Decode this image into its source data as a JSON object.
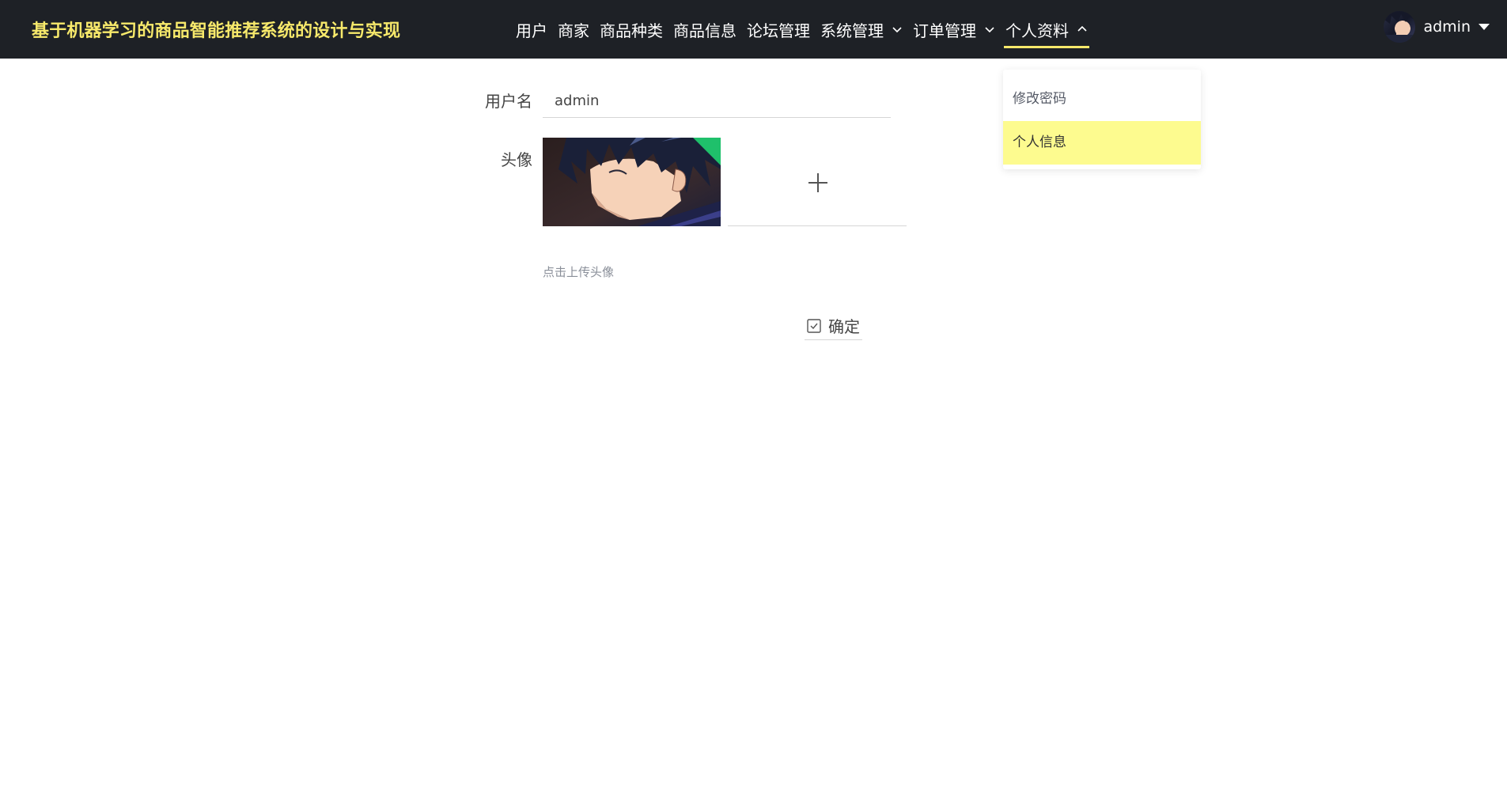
{
  "header": {
    "app_title": "基于机器学习的商品智能推荐系统的设计与实现",
    "nav": [
      {
        "label": "用户",
        "has_dropdown": false
      },
      {
        "label": "商家",
        "has_dropdown": false
      },
      {
        "label": "商品种类",
        "has_dropdown": false
      },
      {
        "label": "商品信息",
        "has_dropdown": false
      },
      {
        "label": "论坛管理",
        "has_dropdown": false
      },
      {
        "label": "系统管理",
        "has_dropdown": true
      },
      {
        "label": "订单管理",
        "has_dropdown": true
      },
      {
        "label": "个人资料",
        "has_dropdown": true,
        "active": true
      }
    ],
    "user": {
      "name": "admin",
      "avatar_icon": "user-avatar"
    }
  },
  "dropdown": {
    "items": [
      {
        "label": "修改密码",
        "selected": false
      },
      {
        "label": "个人信息",
        "selected": true
      }
    ]
  },
  "form": {
    "username_label": "用户名",
    "username_value": "admin",
    "avatar_label": "头像",
    "upload_icon": "plus-icon",
    "upload_tip": "点击上传头像",
    "confirm_label": "确定",
    "confirm_icon": "check-square-icon"
  },
  "colors": {
    "topbar_bg": "#1e2126",
    "title": "#f7e96b",
    "active_underline": "#f7e96b",
    "dropdown_selected_bg": "#fdfb8f",
    "avatar_corner_badge": "#1fc06b"
  }
}
